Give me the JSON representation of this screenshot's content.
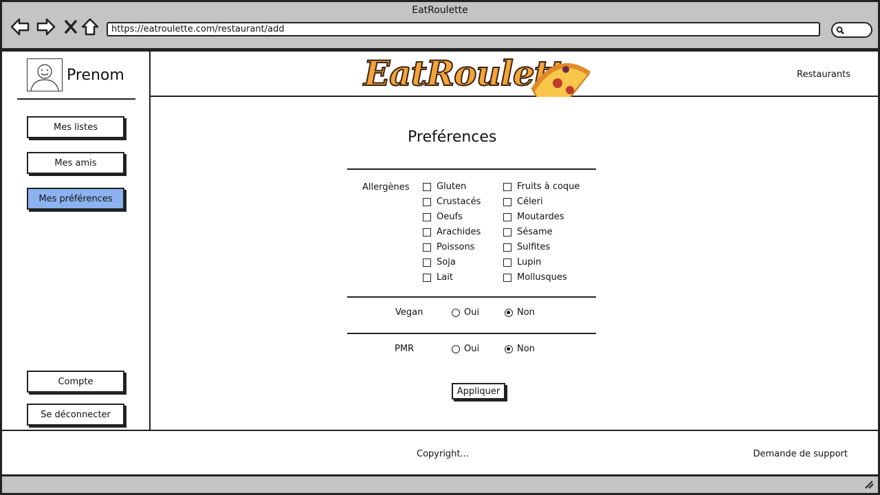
{
  "window": {
    "title": "EatRoulette"
  },
  "browser": {
    "url": "https://eatroulette.com/restaurant/add"
  },
  "profile": {
    "name": "Prenom"
  },
  "sidebar": {
    "items": [
      {
        "label": "Mes listes"
      },
      {
        "label": "Mes amis"
      },
      {
        "label": "Mes préférences",
        "active": true
      }
    ],
    "bottom": [
      {
        "label": "Compte"
      },
      {
        "label": "Se déconnecter"
      }
    ]
  },
  "header": {
    "logo_text": "EatRoulette",
    "nav_restaurants": "Restaurants"
  },
  "main": {
    "title": "Preférences",
    "allergens_label": "Allergènes",
    "allergens_left": [
      "Gluten",
      "Crustacés",
      "Oeufs",
      "Arachides",
      "Poissons",
      "Soja",
      "Lait"
    ],
    "allergens_right": [
      "Fruits à coque",
      "Céleri",
      "Moutardes",
      "Sésame",
      "Sulfites",
      "Lupin",
      "Mollusques"
    ],
    "vegan": {
      "label": "Vegan",
      "yes": "Oui",
      "no": "Non",
      "selected": "Non"
    },
    "pmr": {
      "label": "PMR",
      "yes": "Oui",
      "no": "Non",
      "selected": "Non"
    },
    "apply_label": "Appliquer"
  },
  "footer": {
    "copyright": "Copyright...",
    "support": "Demande de support"
  },
  "colors": {
    "active": "#8cb2f0",
    "logo": "#f4a43a",
    "chrome": "#c4c4c4"
  }
}
